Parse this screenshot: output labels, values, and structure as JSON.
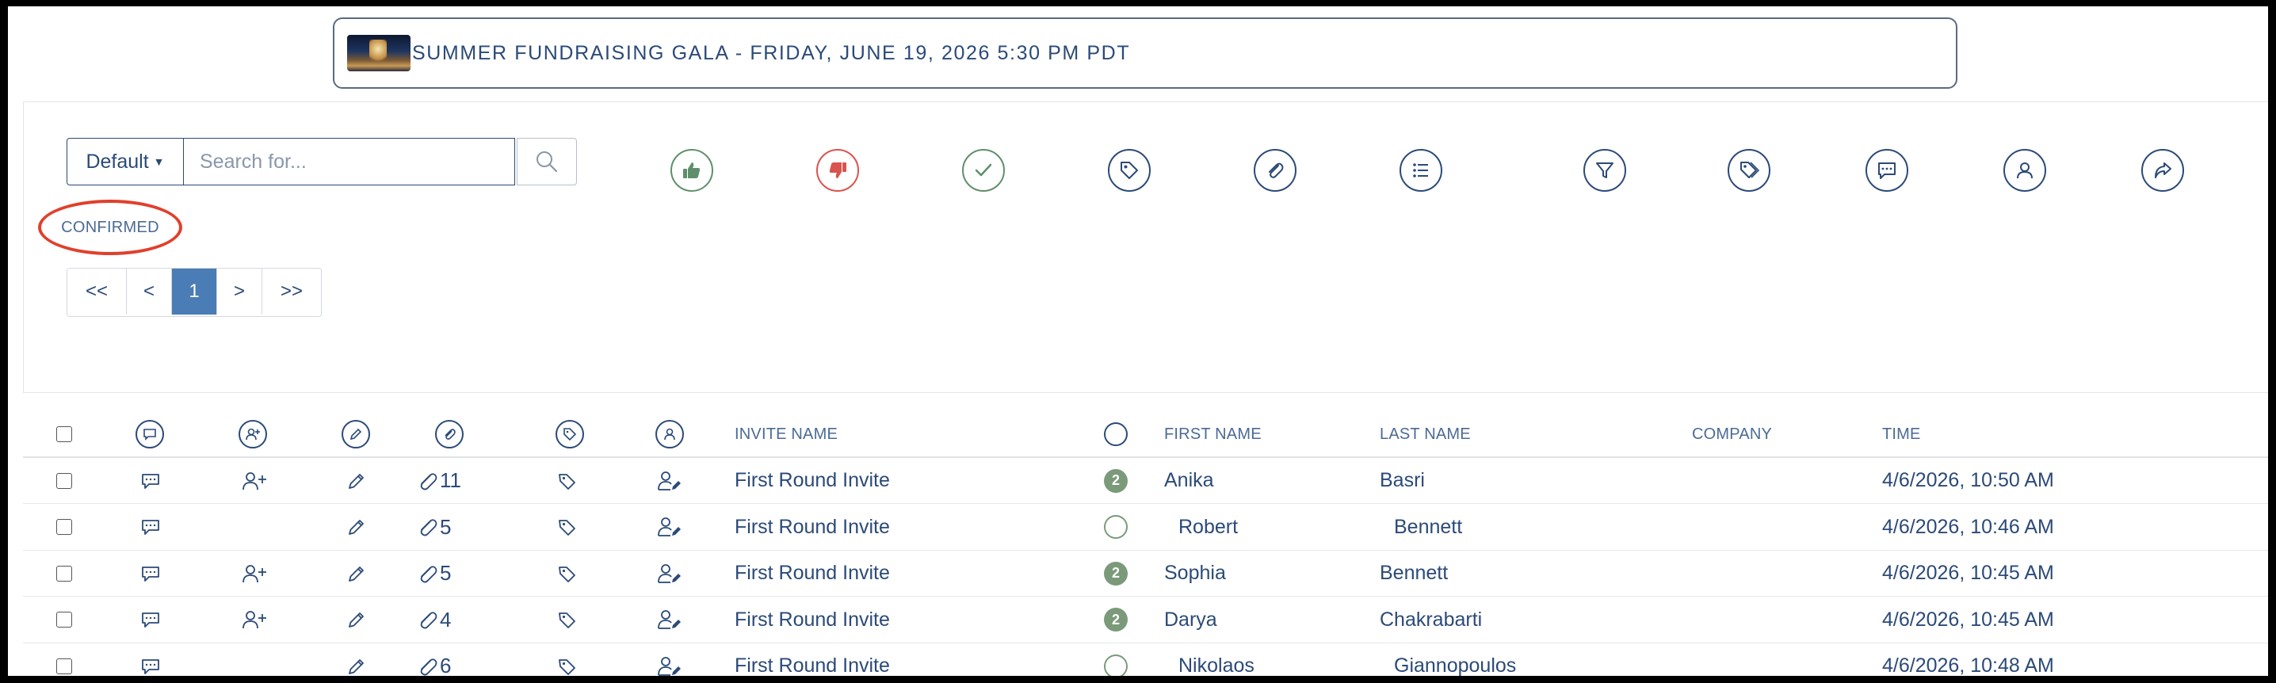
{
  "event": {
    "title": "SUMMER FUNDRAISING GALA - FRIDAY, JUNE 19, 2026 5:30 PM PDT"
  },
  "toolbar": {
    "view_select": "Default",
    "search_placeholder": "Search for...",
    "actions": [
      "thumbs-up-icon",
      "thumbs-down-icon",
      "check-icon",
      "tag-icon",
      "paperclip-icon",
      "list-icon",
      "filter-icon",
      "tags-icon",
      "comment-icon",
      "user-icon",
      "share-icon"
    ],
    "action_colors": {
      "thumbs_up": "#5f8f6a",
      "thumbs_down": "#d9534f",
      "check": "#5f8f6a",
      "default": "#2b4a78"
    }
  },
  "status_filter": "CONFIRMED",
  "pager": [
    "<<",
    "<",
    "1",
    ">",
    ">>"
  ],
  "pager_active": "1",
  "table": {
    "headers": {
      "invite_name": "INVITE NAME",
      "first_name": "FIRST NAME",
      "last_name": "LAST NAME",
      "company": "COMPANY",
      "time": "TIME"
    },
    "rows": [
      {
        "has_add_guest": true,
        "attachments": "11",
        "status_badge": "2",
        "invite_name": "First Round Invite",
        "first_name": "Anika",
        "last_name": "Basri",
        "company": "",
        "time": "4/6/2026, 10:50 AM"
      },
      {
        "has_add_guest": false,
        "attachments": "5",
        "status_badge": "",
        "invite_name": "First Round Invite",
        "first_name": "Robert",
        "last_name": "Bennett",
        "company": "",
        "time": "4/6/2026, 10:46 AM"
      },
      {
        "has_add_guest": true,
        "attachments": "5",
        "status_badge": "2",
        "invite_name": "First Round Invite",
        "first_name": "Sophia",
        "last_name": "Bennett",
        "company": "",
        "time": "4/6/2026, 10:45 AM"
      },
      {
        "has_add_guest": true,
        "attachments": "4",
        "status_badge": "2",
        "invite_name": "First Round Invite",
        "first_name": "Darya",
        "last_name": "Chakrabarti",
        "company": "",
        "time": "4/6/2026, 10:45 AM"
      },
      {
        "has_add_guest": false,
        "attachments": "6",
        "status_badge": "",
        "invite_name": "First Round Invite",
        "first_name": "Nikolaos",
        "last_name": "Giannopoulos",
        "company": "",
        "time": "4/6/2026, 10:48 AM"
      }
    ]
  }
}
